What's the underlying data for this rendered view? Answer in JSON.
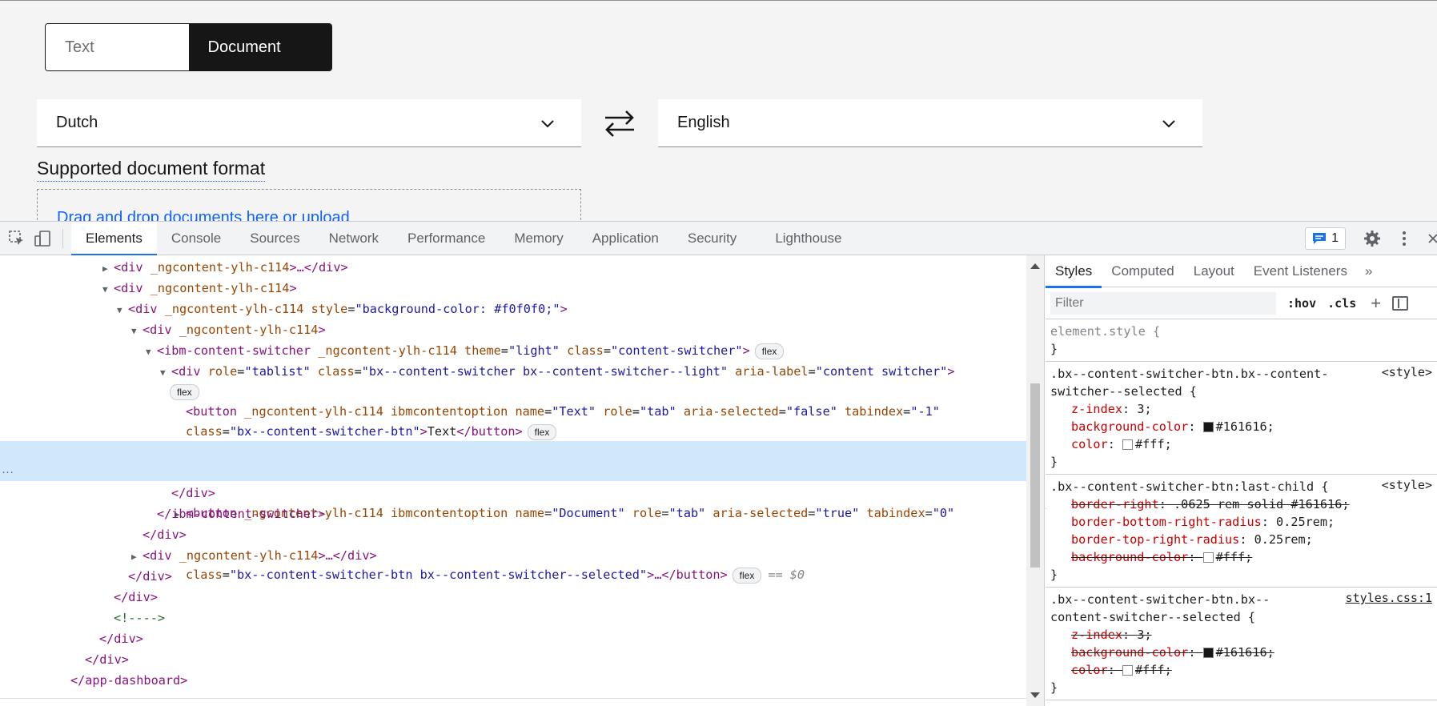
{
  "app": {
    "switcher": {
      "text_label": "Text",
      "document_label": "Document"
    },
    "source_language": "Dutch",
    "target_language": "English",
    "supported_format_label": "Supported document format",
    "dropzone_text": "Drag and drop documents here or upload"
  },
  "devtools": {
    "tabs": [
      "Elements",
      "Console",
      "Sources",
      "Network",
      "Performance",
      "Memory",
      "Application",
      "Security",
      "Lighthouse"
    ],
    "active_tab": "Elements",
    "issues_count": "1",
    "styles": {
      "tabs": [
        "Styles",
        "Computed",
        "Layout",
        "Event Listeners"
      ],
      "more": "»",
      "filter_placeholder": "Filter",
      "hov": ":hov",
      "cls": ".cls",
      "plus": "+",
      "element_style_open": "element.style {",
      "brace_close": "}",
      "rule1": {
        "selector_a": ".bx--content-switcher-btn.bx--content-",
        "selector_b": "switcher--selected {",
        "origin": "<style>",
        "decl1_name": "z-index",
        "decl1_value": "3;",
        "decl2_name": "background-color",
        "decl2_value": "#161616;",
        "decl3_name": "color",
        "decl3_value": "#fff;"
      },
      "rule2": {
        "selector": ".bx--content-switcher-btn:last-child {",
        "origin": "<style>",
        "decl1_name": "border-right",
        "decl1_value": ".0625 rem solid #161616;",
        "decl2_name": "border-bottom-right-radius",
        "decl2_value": "0.25rem;",
        "decl3_name": "border-top-right-radius",
        "decl3_value": "0.25rem;",
        "decl4_name": "background-color",
        "decl4_value": "#fff;"
      },
      "rule3": {
        "selector_a": ".bx--content-switcher-btn.bx--",
        "selector_b": "content-switcher--selected {",
        "origin": "styles.css:1",
        "decl1_name": "z-index",
        "decl1_value": "3;",
        "decl2_name": "background-color",
        "decl2_value": "#161616;",
        "decl3_name": "color",
        "decl3_value": "#fff;"
      }
    },
    "dom": {
      "l1_tag": "<div",
      "l1_attr": " _ngcontent-ylh-c114",
      "l1_end": ">…</div>",
      "l2_tag": "<div",
      "l2_attr": " _ngcontent-ylh-c114",
      "l2_end": ">",
      "l3_tag": "<div",
      "l3_attr": " _ngcontent-ylh-c114 style",
      "l3_eq": "=",
      "l3_val": "\"background-color: #f0f0f0;\"",
      "l3_end": ">",
      "l4_tag": "<div",
      "l4_attr": " _ngcontent-ylh-c114",
      "l4_end": ">",
      "l5_tag": "<ibm-content-switcher",
      "l5_attr1": " _ngcontent-ylh-c114 theme",
      "l5_val1": "\"light\"",
      "l5_attr2": " class",
      "l5_val2": "\"content-switcher\"",
      "l5_end": ">",
      "l6_tag": "<div",
      "l6_attr1": " role",
      "l6_val1": "\"tablist\"",
      "l6_attr2": " class",
      "l6_val2": "\"bx--content-switcher bx--content-switcher--light\"",
      "l6_attr3": " aria-label",
      "l6_val3": "\"content switcher\"",
      "l6_end": ">",
      "flex_badge": "flex",
      "l8_tag": "<button",
      "l8_attr1": " _ngcontent-ylh-c114 ibmcontentoption name",
      "l8_val1": "\"Text\"",
      "l8_attr2": " role",
      "l8_val2": "\"tab\"",
      "l8_attr3": " aria-selected",
      "l8_val3": "\"false\"",
      "l8_attr4": " tabindex",
      "l8_val4": "\"-1\"",
      "l9_attr": "class",
      "l9_val": "\"bx--content-switcher-btn\"",
      "l9_end1": ">",
      "l9_text": "Text",
      "l9_end2": "</button>",
      "l10_tag": "<button",
      "l10_attr1": " _ngcontent-ylh-c114 ibmcontentoption name",
      "l10_val1": "\"Document\"",
      "l10_attr2": " role",
      "l10_val2": "\"tab\"",
      "l10_attr3": " aria-selected",
      "l10_val3": "\"true\"",
      "l10_attr4": " tabindex",
      "l10_val4": "\"0\"",
      "l11_attr": "class",
      "l11_val": "\"bx--content-switcher-btn bx--content-switcher--selected\"",
      "l11_end": ">…</button>",
      "eq0": "== $0",
      "l12": "</div>",
      "l13": "</ibm-content-switcher>",
      "l14": "</div>",
      "l15_tag": "<div",
      "l15_attr": " _ngcontent-ylh-c114",
      "l15_end": ">…</div>",
      "l16": "</div>",
      "l17": "</div>",
      "l18": "<!---->",
      "l19": "</div>",
      "l20": "</div>",
      "l21": "</app-dashboard>",
      "ellipsis": "···"
    }
  }
}
